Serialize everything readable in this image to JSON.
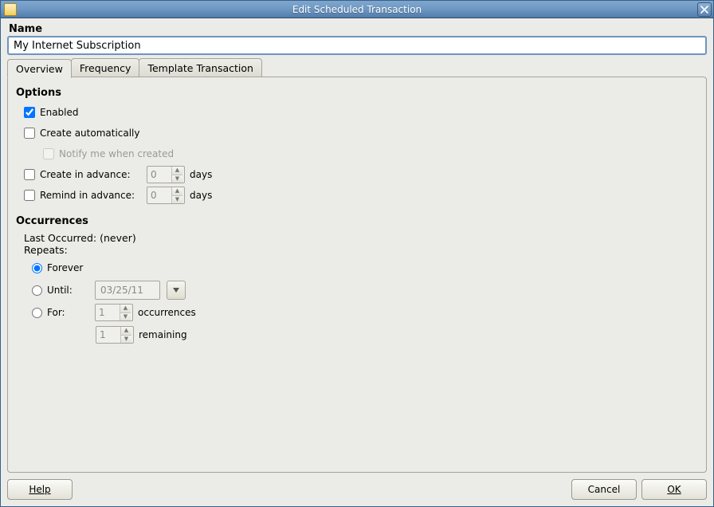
{
  "window": {
    "title": "Edit Scheduled Transaction"
  },
  "name_section": {
    "label": "Name",
    "value": "My Internet Subscription"
  },
  "tabs": [
    {
      "label": "Overview",
      "active": true
    },
    {
      "label": "Frequency",
      "active": false
    },
    {
      "label": "Template Transaction",
      "active": false
    }
  ],
  "options": {
    "heading": "Options",
    "enabled": {
      "label": "Enabled",
      "checked": true
    },
    "create_auto": {
      "label": "Create automatically",
      "checked": false
    },
    "notify": {
      "label": "Notify me when created",
      "checked": false,
      "disabled": true
    },
    "create_advance": {
      "label": "Create in advance:",
      "checked": false,
      "value": "0",
      "unit": "days"
    },
    "remind_advance": {
      "label": "Remind in advance:",
      "checked": false,
      "value": "0",
      "unit": "days"
    }
  },
  "occurrences": {
    "heading": "Occurrences",
    "last_label": "Last Occurred: ",
    "last_value": "(never)",
    "repeats_label": "Repeats:",
    "forever": {
      "label": "Forever",
      "selected": true
    },
    "until": {
      "label": "Until:",
      "selected": false,
      "date": "03/25/11"
    },
    "for": {
      "label": "For:",
      "selected": false,
      "occurrences_value": "1",
      "occurrences_unit": "occurrences",
      "remaining_value": "1",
      "remaining_unit": "remaining"
    }
  },
  "buttons": {
    "help": "Help",
    "cancel": "Cancel",
    "ok": "OK"
  }
}
